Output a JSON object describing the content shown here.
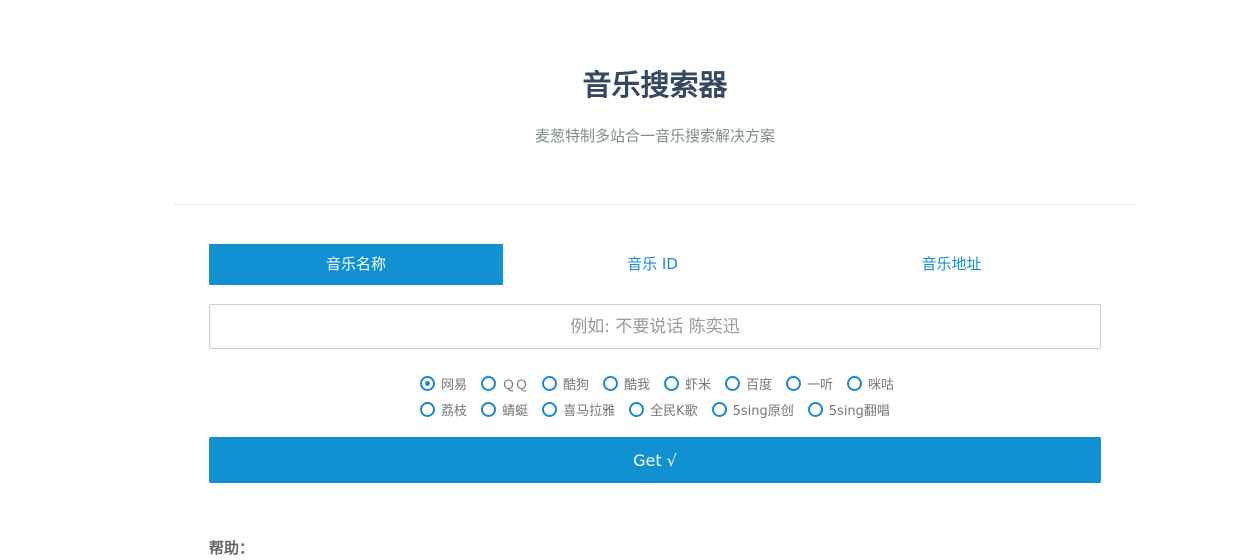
{
  "header": {
    "title": "音乐搜索器",
    "subtitle": "麦葱特制多站合一音乐搜索解决方案"
  },
  "tabs": [
    {
      "label": "音乐名称",
      "active": true
    },
    {
      "label": "音乐 ID",
      "active": false
    },
    {
      "label": "音乐地址",
      "active": false
    }
  ],
  "search": {
    "placeholder": "例如: 不要说话 陈奕迅",
    "value": ""
  },
  "sources_row1": [
    {
      "label": "网易",
      "checked": true
    },
    {
      "label": "ＱＱ"
    },
    {
      "label": "酷狗"
    },
    {
      "label": "酷我"
    },
    {
      "label": "虾米"
    },
    {
      "label": "百度"
    },
    {
      "label": "一听"
    },
    {
      "label": "咪咕"
    }
  ],
  "sources_row2": [
    {
      "label": "荔枝"
    },
    {
      "label": "蜻蜓"
    },
    {
      "label": "喜马拉雅"
    },
    {
      "label": "全民K歌"
    },
    {
      "label": "5sing原创"
    },
    {
      "label": "5sing翻唱"
    }
  ],
  "submit": {
    "label": "Get √"
  },
  "help": {
    "label": "帮助："
  },
  "colors": {
    "accent": "#1191d2",
    "title": "#34495e"
  }
}
